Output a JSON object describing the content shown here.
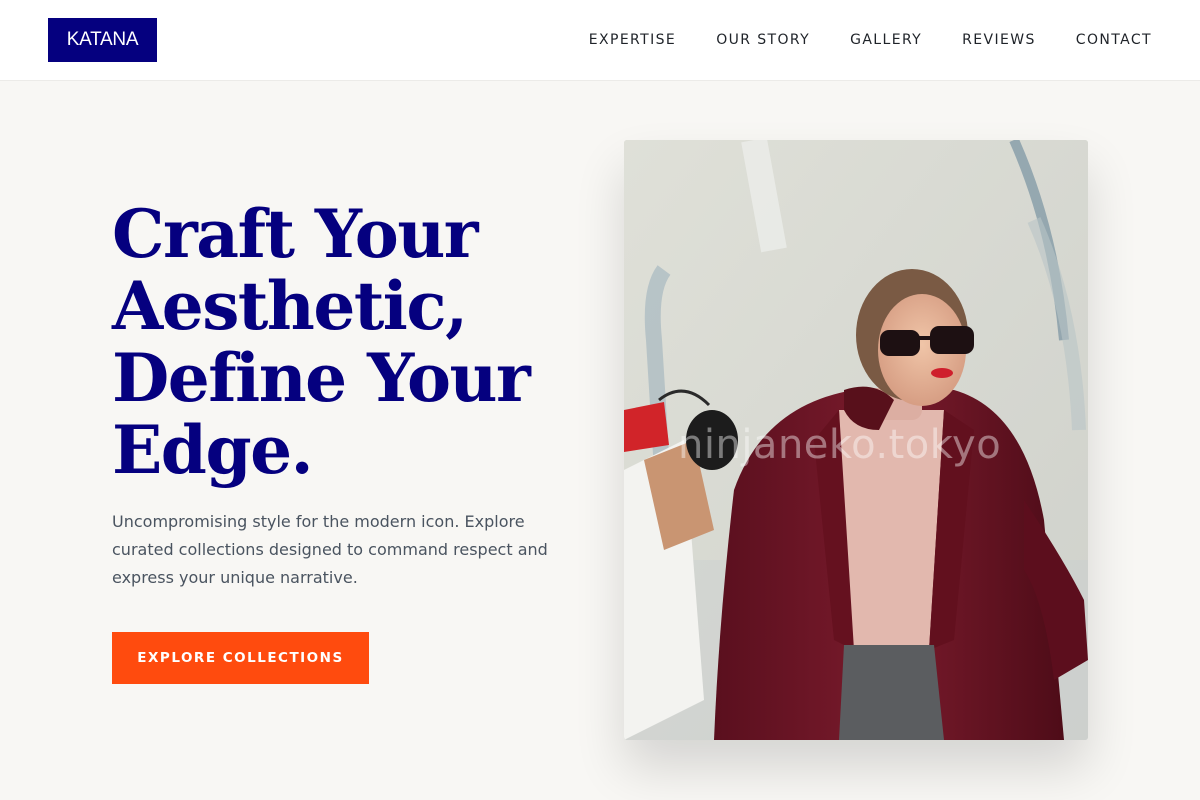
{
  "header": {
    "logo": "KATANA",
    "nav": [
      {
        "label": "EXPERTISE"
      },
      {
        "label": "OUR STORY"
      },
      {
        "label": "GALLERY"
      },
      {
        "label": "REVIEWS"
      },
      {
        "label": "CONTACT"
      }
    ]
  },
  "hero": {
    "title_lines": [
      "Craft Your",
      "Aesthetic,",
      "Define Your",
      "Edge."
    ],
    "subtitle": "Uncompromising style for the modern icon. Explore curated collections designed to command respect and express your unique narrative.",
    "cta_label": "EXPLORE COLLECTIONS",
    "image": {
      "watermark": "ninjaneko.tokyo"
    }
  },
  "colors": {
    "brand": "#05007f",
    "accent": "#ff4b0e",
    "background": "#f8f7f4",
    "header_bg": "#ffffff",
    "body_text": "#4a5460",
    "nav_text": "#1f2329"
  }
}
